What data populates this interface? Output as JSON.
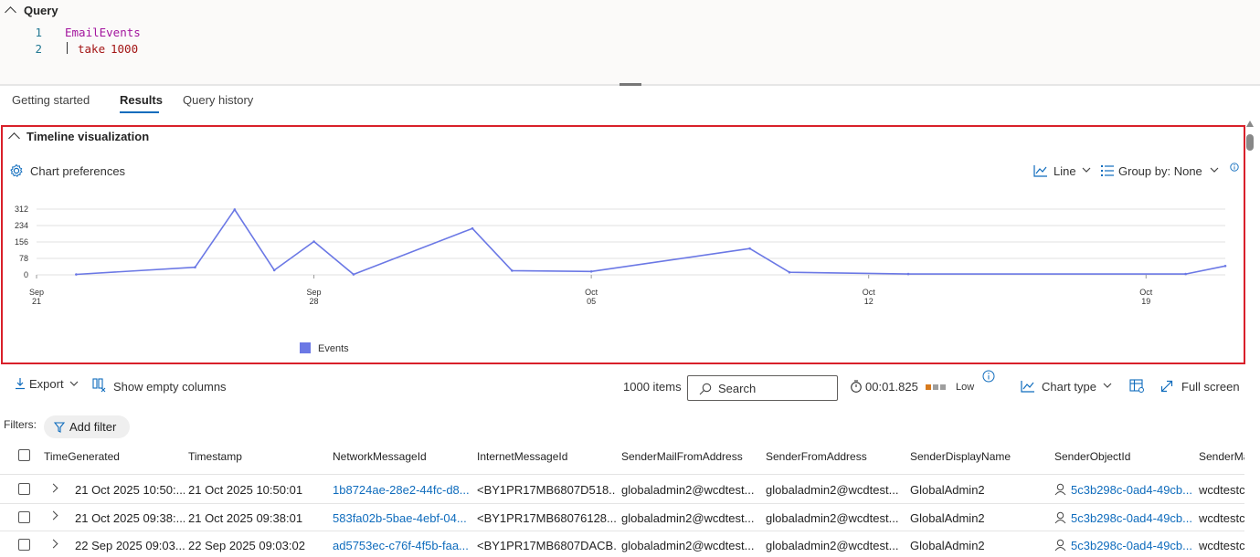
{
  "query": {
    "title": "Query",
    "lines": [
      {
        "num": "1",
        "table": "EmailEvents"
      },
      {
        "num": "2",
        "pipe": "|",
        "op": "take",
        "value": "1000"
      }
    ]
  },
  "tabs": [
    "Getting started",
    "Results",
    "Query history"
  ],
  "active_tab": "Results",
  "timeline": {
    "title": "Timeline visualization",
    "chart_preferences": "Chart preferences",
    "chart_type_label": "Line",
    "group_by_label": "Group by: None",
    "legend": "Events"
  },
  "chart_data": {
    "type": "line",
    "title": "",
    "xlabel": "",
    "ylabel": "",
    "yticks": [
      0,
      78,
      156,
      234,
      312
    ],
    "ylim": [
      0,
      312
    ],
    "xticks": [
      {
        "top": "Sep",
        "bottom": "21",
        "date": "2025-09-21"
      },
      {
        "top": "Sep",
        "bottom": "28",
        "date": "2025-09-28"
      },
      {
        "top": "Oct",
        "bottom": "05",
        "date": "2025-10-05"
      },
      {
        "top": "Oct",
        "bottom": "12",
        "date": "2025-10-12"
      },
      {
        "top": "Oct",
        "bottom": "19",
        "date": "2025-10-19"
      }
    ],
    "xlim": [
      "2025-09-21",
      "2025-10-21"
    ],
    "grid": true,
    "legend_position": "bottom-left",
    "series": [
      {
        "name": "Events",
        "color": "#6b78e5",
        "points": [
          {
            "x": "2025-09-22",
            "y": 2
          },
          {
            "x": "2025-09-25",
            "y": 36
          },
          {
            "x": "2025-09-26",
            "y": 310
          },
          {
            "x": "2025-09-27",
            "y": 22
          },
          {
            "x": "2025-09-28",
            "y": 158
          },
          {
            "x": "2025-09-29",
            "y": 2
          },
          {
            "x": "2025-10-02",
            "y": 220
          },
          {
            "x": "2025-10-03",
            "y": 20
          },
          {
            "x": "2025-10-05",
            "y": 16
          },
          {
            "x": "2025-10-09",
            "y": 125
          },
          {
            "x": "2025-10-10",
            "y": 12
          },
          {
            "x": "2025-10-13",
            "y": 4
          },
          {
            "x": "2025-10-20",
            "y": 4
          },
          {
            "x": "2025-10-21",
            "y": 42
          }
        ]
      }
    ]
  },
  "toolbar": {
    "export": "Export",
    "show_empty_columns": "Show empty columns",
    "items_count": "1000 items",
    "search_placeholder": "Search",
    "duration": "00:01.825",
    "cost_level": "Low",
    "chart_type": "Chart type",
    "full_screen": "Full screen"
  },
  "filters": {
    "label": "Filters:",
    "add_filter": "Add filter"
  },
  "table": {
    "columns": [
      "TimeGenerated",
      "Timestamp",
      "NetworkMessageId",
      "InternetMessageId",
      "SenderMailFromAddress",
      "SenderFromAddress",
      "SenderDisplayName",
      "SenderObjectId",
      "SenderMa"
    ],
    "rows": [
      [
        "21 Oct 2025 10:50:...",
        "21 Oct 2025 10:50:01",
        "1b8724ae-28e2-44fc-d8...",
        "<BY1PR17MB6807D518...",
        "globaladmin2@wcdtest...",
        "globaladmin2@wcdtest...",
        "GlobalAdmin2",
        "5c3b298c-0ad4-49cb....",
        "wcdtestc"
      ],
      [
        "21 Oct 2025 09:38:...",
        "21 Oct 2025 09:38:01",
        "583fa02b-5bae-4ebf-04...",
        "<BY1PR17MB68076128...",
        "globaladmin2@wcdtest...",
        "globaladmin2@wcdtest...",
        "GlobalAdmin2",
        "5c3b298c-0ad4-49cb....",
        "wcdtestc"
      ],
      [
        "22 Sep 2025 09:03...",
        "22 Sep 2025 09:03:02",
        "ad5753ec-c76f-4f5b-faa...",
        "<BY1PR17MB6807DACB...",
        "globaladmin2@wcdtest...",
        "globaladmin2@wcdtest...",
        "GlobalAdmin2",
        "5c3b298c-0ad4-49cb....",
        "wcdtestc"
      ]
    ]
  }
}
